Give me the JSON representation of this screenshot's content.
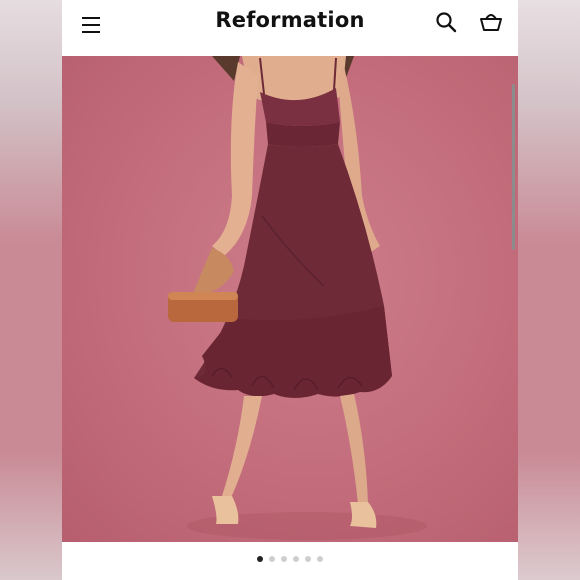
{
  "header": {
    "brand": "Reformation",
    "icons": [
      "menu-icon",
      "search-icon",
      "shopping-bag-icon"
    ]
  },
  "carousel": {
    "image_subject": "product-photo-dress",
    "slide_count": 6,
    "active_index": 0
  },
  "colors": {
    "background_pink": "#c36d7c",
    "dress_burgundy": "#6e2a36",
    "header_bg": "#ffffff",
    "dot_active": "#222222",
    "dot_inactive": "#cfcfcf"
  }
}
